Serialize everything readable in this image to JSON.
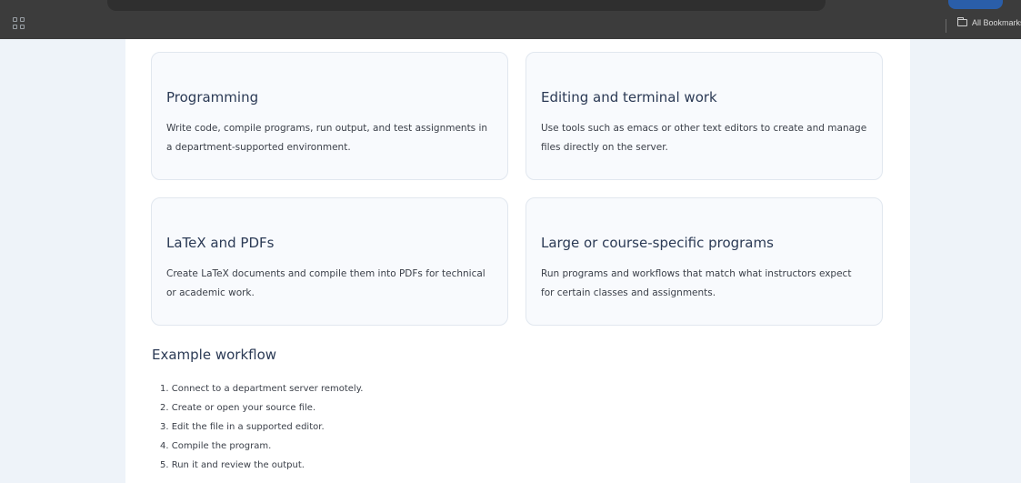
{
  "browser": {
    "bookmarks_label": "All Bookmarks"
  },
  "cards": [
    {
      "title": "Programming",
      "text": "Write code, compile programs, run output, and test assignments in a department-supported environment."
    },
    {
      "title": "Editing and terminal work",
      "text": "Use tools such as emacs or other text editors to create and manage files directly on the server."
    },
    {
      "title": "LaTeX and PDFs",
      "text": "Create LaTeX documents and compile them into PDFs for technical or academic work."
    },
    {
      "title": "Large or course-specific programs",
      "text": "Run programs and workflows that match what instructors expect for certain classes and assignments."
    }
  ],
  "workflow": {
    "title": "Example workflow",
    "steps": [
      "1. Connect to a department server remotely.",
      "2. Create or open your source file.",
      "3. Edit the file in a supported editor.",
      "4. Compile the program.",
      "5. Run it and review the output."
    ]
  }
}
